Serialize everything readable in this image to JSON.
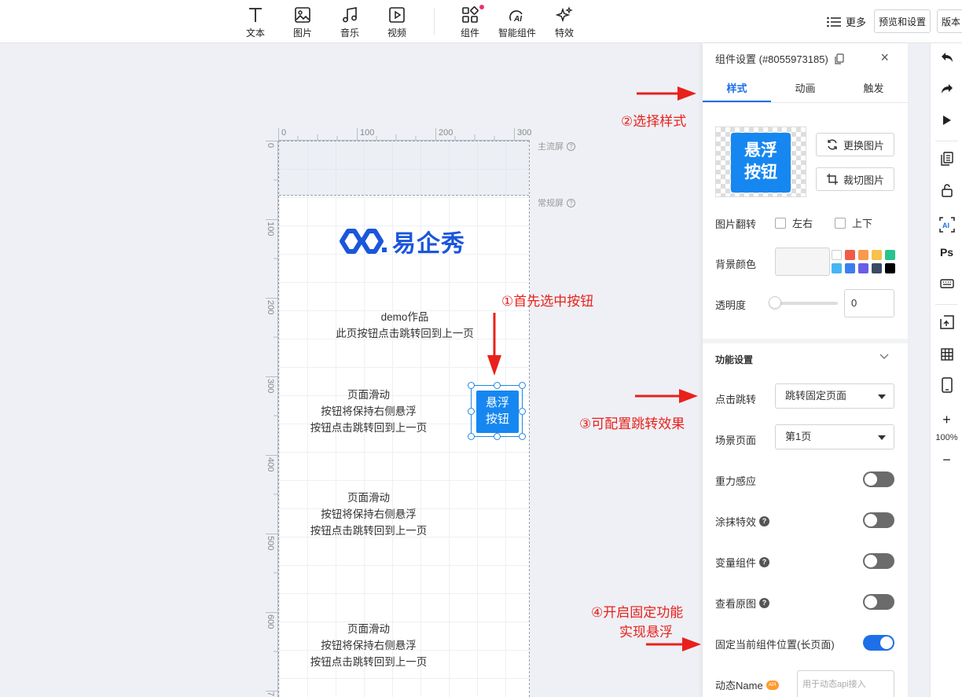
{
  "toolbar": {
    "items": [
      {
        "label": "文本",
        "icon": "text-icon"
      },
      {
        "label": "图片",
        "icon": "image-icon"
      },
      {
        "label": "音乐",
        "icon": "music-icon"
      },
      {
        "label": "视频",
        "icon": "video-icon"
      },
      {
        "label": "组件",
        "icon": "components-icon"
      },
      {
        "label": "智能组件",
        "icon": "ai-components-icon"
      },
      {
        "label": "特效",
        "icon": "effects-icon"
      }
    ],
    "more_label": "更多",
    "preview_settings_label": "预览和设置",
    "version_label": "版本"
  },
  "canvas": {
    "ruler_top": [
      "0",
      "100",
      "200",
      "300"
    ],
    "ruler_left": [
      "0",
      "100",
      "200",
      "300",
      "400",
      "500",
      "600",
      "7"
    ],
    "main_flow_label": "主流屏",
    "normal_label": "常规屏",
    "logo_text": "易企秀",
    "texts": [
      {
        "lines": [
          "demo作品",
          "此页按钮点击跳转回到上一页"
        ]
      },
      {
        "lines": [
          "页面滑动",
          "按钮将保持右侧悬浮",
          "按钮点击跳转回到上一页"
        ]
      },
      {
        "lines": [
          "页面滑动",
          "按钮将保持右侧悬浮",
          "按钮点击跳转回到上一页"
        ]
      },
      {
        "lines": [
          "页面滑动",
          "按钮将保持右侧悬浮",
          "按钮点击跳转回到上一页"
        ]
      }
    ],
    "float_button": {
      "line1": "悬浮",
      "line2": "按钮"
    }
  },
  "annotations": {
    "step1": "①首先选中按钮",
    "step2": "②选择样式",
    "step3": "③可配置跳转效果",
    "step4_line1": "④开启固定功能",
    "step4_line2": "实现悬浮"
  },
  "panel": {
    "title": "组件设置 (#8055973185)",
    "tabs": [
      "样式",
      "动画",
      "触发"
    ],
    "active_tab": "样式",
    "preview": {
      "line1": "悬浮",
      "line2": "按钮"
    },
    "replace_image": "更换图片",
    "crop_image": "裁切图片",
    "flip_label": "图片翻转",
    "flip_lr": "左右",
    "flip_ud": "上下",
    "bg_color_label": "背景颜色",
    "swatches": [
      "#ffffff",
      "#f15a4a",
      "#f79a4c",
      "#f8c14a",
      "#2ac38c",
      "#46b5f5",
      "#3a7ff0",
      "#6a5de8",
      "#3c4a66",
      "#000000"
    ],
    "opacity_label": "透明度",
    "opacity_value": "0",
    "function_section": "功能设置",
    "click_jump_label": "点击跳转",
    "click_jump_value": "跳转固定页面",
    "scene_page_label": "场景页面",
    "scene_page_value": "第1页",
    "gravity_label": "重力感应",
    "smear_label": "涂抹特效",
    "variable_label": "变量组件",
    "original_label": "查看原图",
    "fixed_label": "固定当前组件位置(长页面)",
    "dynamic_name_label": "动态Name",
    "dynamic_name_placeholder": "用于动态api接入",
    "toggles": {
      "gravity": false,
      "smear": false,
      "variable": false,
      "original": false,
      "fixed": true
    }
  },
  "rightbar": {
    "zoom": "100%",
    "ps_label": "Ps",
    "ai_label": "AI"
  },
  "colors": {
    "accent": "#1e6fe8",
    "button_blue": "#1687f0",
    "annotation_red": "#e8211c"
  }
}
